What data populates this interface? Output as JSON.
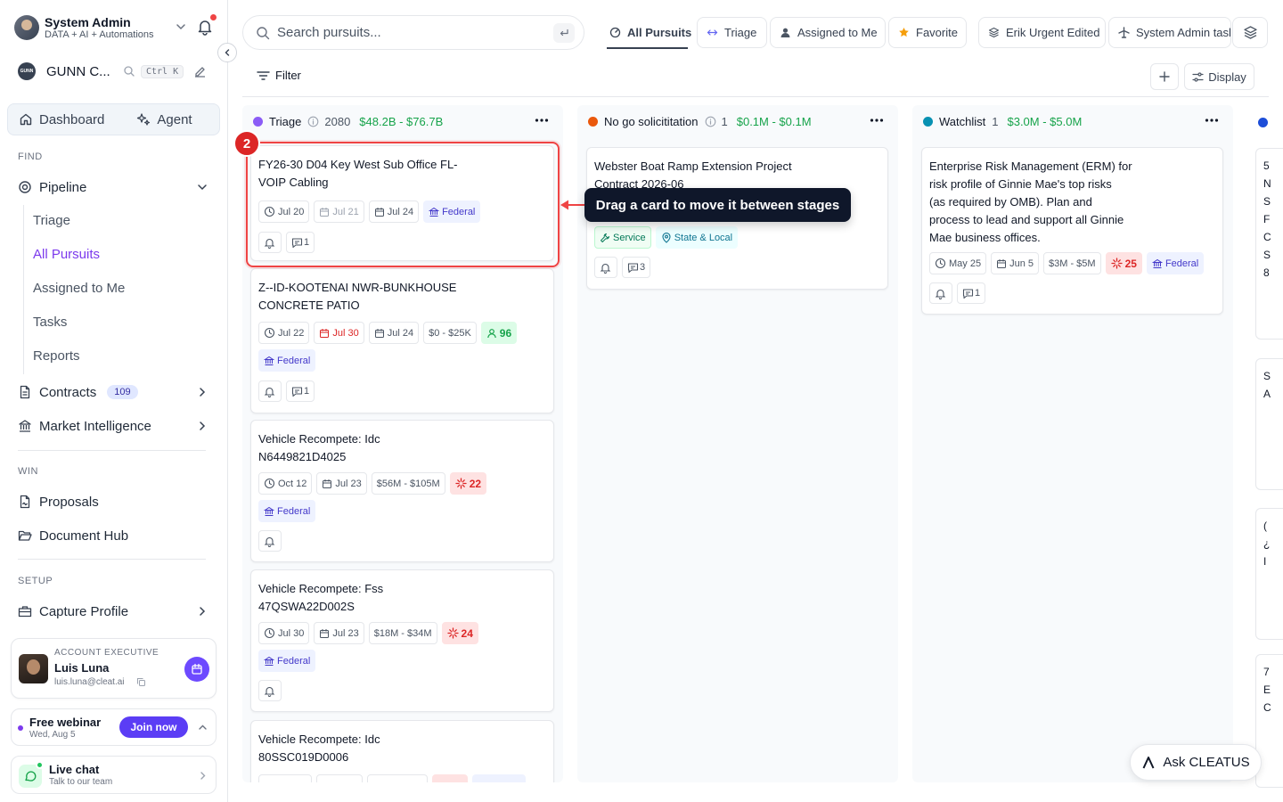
{
  "user": {
    "name": "System Admin",
    "subtitle": "DATA + AI + Automations"
  },
  "org": {
    "logo_text": "GUNN",
    "name": "GUNN C...",
    "shortcut": "Ctrl K"
  },
  "top_nav": {
    "dashboard": "Dashboard",
    "agent": "Agent"
  },
  "sections": {
    "find": "FIND",
    "win": "WIN",
    "setup": "SETUP"
  },
  "nav": {
    "pipeline": "Pipeline",
    "pipeline_sub": [
      "Triage",
      "All Pursuits",
      "Assigned to Me",
      "Tasks",
      "Reports"
    ],
    "contracts": "Contracts",
    "contracts_count": "109",
    "market_intel": "Market Intelligence",
    "proposals": "Proposals",
    "document_hub": "Document Hub",
    "capture_profile": "Capture Profile"
  },
  "account_exec": {
    "role": "ACCOUNT EXECUTIVE",
    "name": "Luis Luna",
    "email": "luis.luna@cleat.ai"
  },
  "webinar": {
    "title": "Free webinar",
    "date": "Wed, Aug 5",
    "cta": "Join now"
  },
  "live_chat": {
    "title": "Live chat",
    "subtitle": "Talk to our team"
  },
  "search": {
    "placeholder": "Search pursuits..."
  },
  "tabs": [
    "All Pursuits",
    "Triage",
    "Assigned to Me",
    "Favorite",
    "Erik Urgent Edited",
    "System Admin task"
  ],
  "toolbar": {
    "filter": "Filter",
    "display": "Display"
  },
  "columns": [
    {
      "name": "Triage",
      "count": "2080",
      "range": "$48.2B - $76.7B",
      "color": "#8b5cf6",
      "cards": [
        {
          "title_lines": [
            "FY26-30 D04 Key West Sub Office FL-",
            "VOIP Cabling"
          ],
          "chips": [
            "Jul 20",
            "Jul 21",
            "Jul 24",
            "Federal"
          ],
          "comments": "1"
        },
        {
          "title_lines": [
            "Z--ID-KOOTENAI NWR-BUNKHOUSE",
            "CONCRETE PATIO"
          ],
          "chips": [
            "Jul 22",
            "Jul 30",
            "Jul 24",
            "$0 - $25K",
            "96",
            "Federal"
          ],
          "comments": "1"
        },
        {
          "title_lines": [
            "Vehicle Recompete: Idc",
            "N6449821D4025"
          ],
          "chips": [
            "Oct 12",
            "Jul 23",
            "$56M - $105M",
            "22",
            "Federal"
          ]
        },
        {
          "title_lines": [
            "Vehicle Recompete: Fss",
            "47QSWA22D002S"
          ],
          "chips": [
            "Jul 30",
            "Jul 23",
            "$18M - $34M",
            "24",
            "Federal"
          ]
        },
        {
          "title_lines": [
            "Vehicle Recompete: Idc",
            "80SSC019D0006"
          ]
        }
      ]
    },
    {
      "name": "No go solicititation",
      "count": "1",
      "range": "$0.1M - $0.1M",
      "color": "#ea580c",
      "cards": [
        {
          "title_lines": [
            "Webster Boat Ramp Extension Project",
            "Contract 2026-06"
          ],
          "chips": [
            "Service",
            "State & Local"
          ],
          "comments": "3"
        }
      ]
    },
    {
      "name": "Watchlist",
      "count": "1",
      "range": "$3.0M - $5.0M",
      "color": "#0891b2",
      "cards": [
        {
          "title_lines": [
            "Enterprise Risk Management (ERM) for",
            "risk profile of Ginnie Mae's top risks",
            "(as required by OMB). Plan and",
            "process to lead and support all Ginnie",
            "Mae business offices."
          ],
          "chips": [
            "May 25",
            "Jun 5",
            "$3M - $5M",
            "25",
            "Federal"
          ],
          "comments": "1"
        }
      ]
    }
  ],
  "peek_letters": [
    "5",
    "N",
    "S",
    "F",
    "C",
    "S",
    "8",
    "S",
    "A",
    "(",
    "¿",
    "I",
    "7",
    "E",
    "C"
  ],
  "tooltip": {
    "step": "2",
    "text": "Drag a card to move it between stages"
  },
  "ask": {
    "label": "Ask CLEATUS"
  },
  "colors": {
    "accent": "#7c3aed",
    "primary_button": "#5b3df5",
    "highlight": "#ef4444",
    "tooltip_bg": "#0f172a",
    "green": "#16a34a"
  }
}
